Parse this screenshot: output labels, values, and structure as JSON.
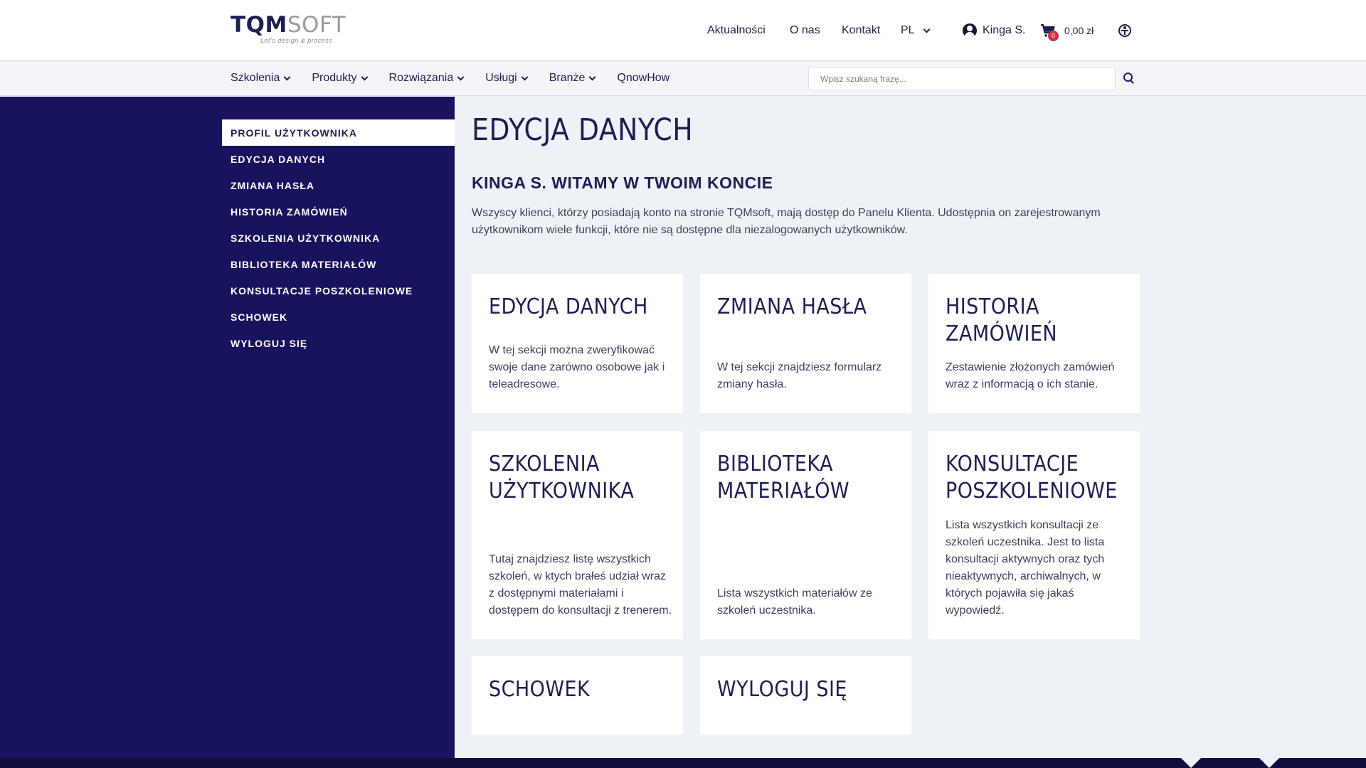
{
  "logo": {
    "main_a": "TQM",
    "main_b": "SOFT",
    "tagline": "Let's design & process"
  },
  "topnav": {
    "news": "Aktualności",
    "about": "O nas",
    "contact": "Kontakt",
    "lang": "PL",
    "user": "Kinga S.",
    "cart_count": "0",
    "cart_total": "0,00 zł"
  },
  "menu": {
    "items": [
      "Szkolenia",
      "Produkty",
      "Rozwiązania",
      "Usługi",
      "Branże",
      "QnowHow"
    ]
  },
  "search": {
    "placeholder": "Wpisz szukaną frazę..."
  },
  "sidebar": {
    "items": [
      "PROFIL UŻYTKOWNIKA",
      "EDYCJA DANYCH",
      "ZMIANA HASŁA",
      "HISTORIA ZAMÓWIEŃ",
      "SZKOLENIA UŻYTKOWNIKA",
      "BIBLIOTEKA MATERIAŁÓW",
      "KONSULTACJE POSZKOLENIOWE",
      "SCHOWEK",
      "WYLOGUJ SIĘ"
    ]
  },
  "main": {
    "title": "EDYCJA DANYCH",
    "welcome": "KINGA S. WITAMY W TWOIM KONCIE",
    "intro": "Wszyscy klienci, którzy posiadają konto na stronie TQMsoft, mają dostęp do Panelu Klienta. Udostępnia on zarejestrowanym użytkownikom wiele funkcji, które nie są dostępne dla niezalogowanych użytkowników.",
    "cards": [
      {
        "title": "EDYCJA DANYCH",
        "desc": "W tej sekcji można zweryfikować swoje dane zarówno osobowe jak i teleadresowe."
      },
      {
        "title": "ZMIANA HASŁA",
        "desc": "W tej sekcji znajdziesz formularz zmiany hasła."
      },
      {
        "title": "HISTORIA ZAMÓWIEŃ",
        "desc": "Zestawienie złożonych zamówień wraz z informacją o ich stanie."
      },
      {
        "title": "SZKOLENIA UŻYTKOWNIKA",
        "desc": "Tutaj znajdziesz listę wszystkich szkoleń, w ktych brałeś udział wraz z dostępnymi materiałami i dostępem do konsultacji z trenerem."
      },
      {
        "title": "BIBLIOTEKA MATERIAŁÓW",
        "desc": "Lista wszystkich materiałów ze szkoleń uczestnika."
      },
      {
        "title": "KONSULTACJE POSZKOLENIOWE",
        "desc": "Lista wszystkich konsultacji ze szkoleń uczestnika. Jest to lista konsultacji aktywnych oraz tych nieaktywnych, archiwalnych, w których pojawiła się jakaś wypowiedź."
      },
      {
        "title": "SCHOWEK",
        "desc": ""
      },
      {
        "title": "WYLOGUJ SIĘ",
        "desc": ""
      }
    ]
  }
}
